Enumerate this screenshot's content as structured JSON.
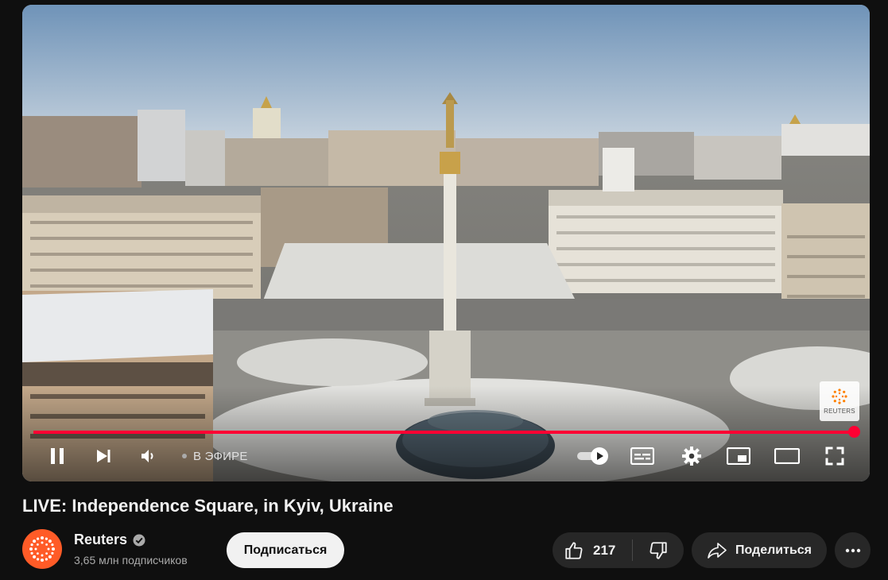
{
  "player": {
    "status_label": "В ЭФИРЕ",
    "progress": 1.0,
    "watermark_text": "REUTERS",
    "controls": {
      "play_pause_icon": "pause-icon",
      "next_icon": "skip-next-icon",
      "volume_icon": "volume-icon",
      "autoplay_icon": "autoplay-toggle-icon",
      "subtitles_icon": "subtitles-icon",
      "settings_icon": "gear-icon",
      "miniplayer_icon": "miniplayer-icon",
      "theater_icon": "theater-mode-icon",
      "fullscreen_icon": "fullscreen-icon"
    },
    "accent_color": "#ff0033"
  },
  "video": {
    "title": "LIVE: Independence Square, in Kyiv, Ukraine"
  },
  "channel": {
    "name": "Reuters",
    "verified": true,
    "subscribers": "3,65 млн подписчиков",
    "avatar_color": "#ff5b27"
  },
  "actions": {
    "subscribe_label": "Подписаться",
    "like_count": "217",
    "share_label": "Поделиться"
  }
}
